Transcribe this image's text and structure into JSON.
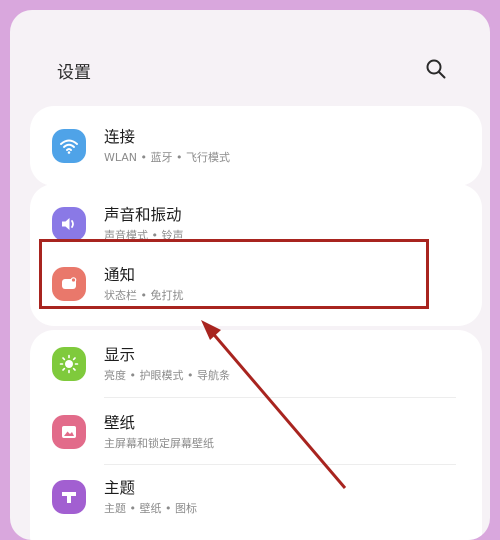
{
  "header": {
    "title": "设置",
    "search_icon": "search-icon"
  },
  "items": [
    {
      "label": "连接",
      "sub": "WLAN • 蓝牙 • 飞行模式",
      "icon": "wifi-icon",
      "color": "#4fa3e8"
    },
    {
      "label": "声音和振动",
      "sub": "声音模式 • 铃声",
      "icon": "volume-icon",
      "color": "#8a79e6"
    },
    {
      "label": "通知",
      "sub": "状态栏 • 免打扰",
      "icon": "notification-icon",
      "color": "#e9786b"
    },
    {
      "label": "显示",
      "sub": "亮度 • 护眼模式 • 导航条",
      "icon": "display-icon",
      "color": "#7fca3c"
    },
    {
      "label": "壁纸",
      "sub": "主屏幕和锁定屏幕壁纸",
      "icon": "wallpaper-icon",
      "color": "#e26b8a"
    },
    {
      "label": "主题",
      "sub": "主题 • 壁纸 • 图标",
      "icon": "theme-icon",
      "color": "#a25fd1"
    }
  ],
  "annotation": {
    "color": "#a8241f"
  }
}
